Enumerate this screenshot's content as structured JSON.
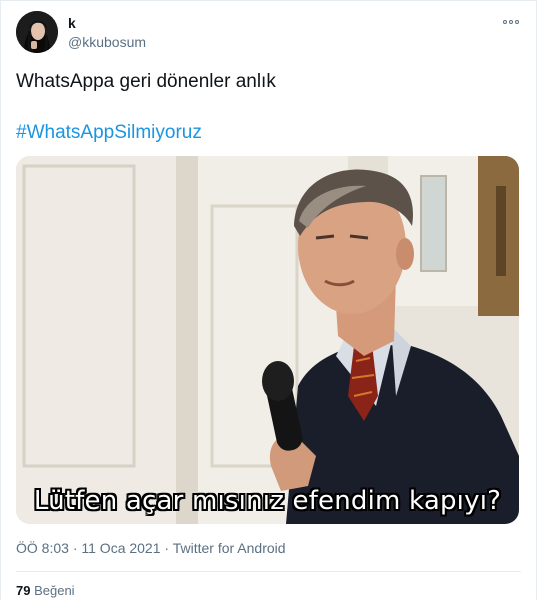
{
  "user": {
    "display_name": "k",
    "handle": "@kkubosum",
    "avatar_icon": "profile-avatar"
  },
  "tweet": {
    "text": "WhatsAppa geri dönenler anlık",
    "hashtag": "#WhatsAppSilmiyoruz",
    "media_caption": "Lütfen açar mısınız efendim kapıyı?",
    "time": "ÖÖ 8:03",
    "date": "11 Oca 2021",
    "separator": "·",
    "client": "Twitter for Android"
  },
  "stats": {
    "likes_count": "79",
    "likes_label": "Beğeni"
  },
  "colors": {
    "link": "#1b95e0",
    "secondary_text": "#5b7083",
    "primary_text": "#0f1419"
  },
  "icons": {
    "more": "more-options-icon"
  }
}
